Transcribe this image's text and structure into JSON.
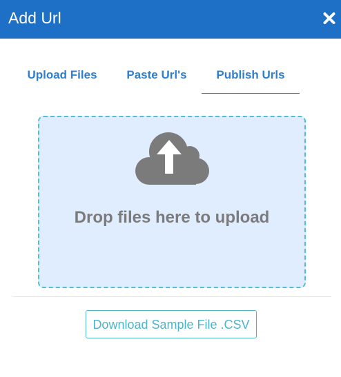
{
  "dialog": {
    "title": "Add Url",
    "close_icon": "close-icon"
  },
  "tabs": [
    {
      "label": "Upload Files",
      "active": false
    },
    {
      "label": "Paste Url's",
      "active": false
    },
    {
      "label": "Publish Urls",
      "active": true
    }
  ],
  "dropzone": {
    "icon": "cloud-upload-icon",
    "text": "Drop files here to upload"
  },
  "download": {
    "label": "Download Sample File .CSV"
  },
  "colors": {
    "header": "#1e6fc6",
    "tab_text": "#2f7fd0",
    "dropzone_bg": "#e0edff",
    "dropzone_border": "#4ec0d4",
    "icon_gray": "#7c7b7b",
    "download_accent": "#4cb6c7"
  }
}
